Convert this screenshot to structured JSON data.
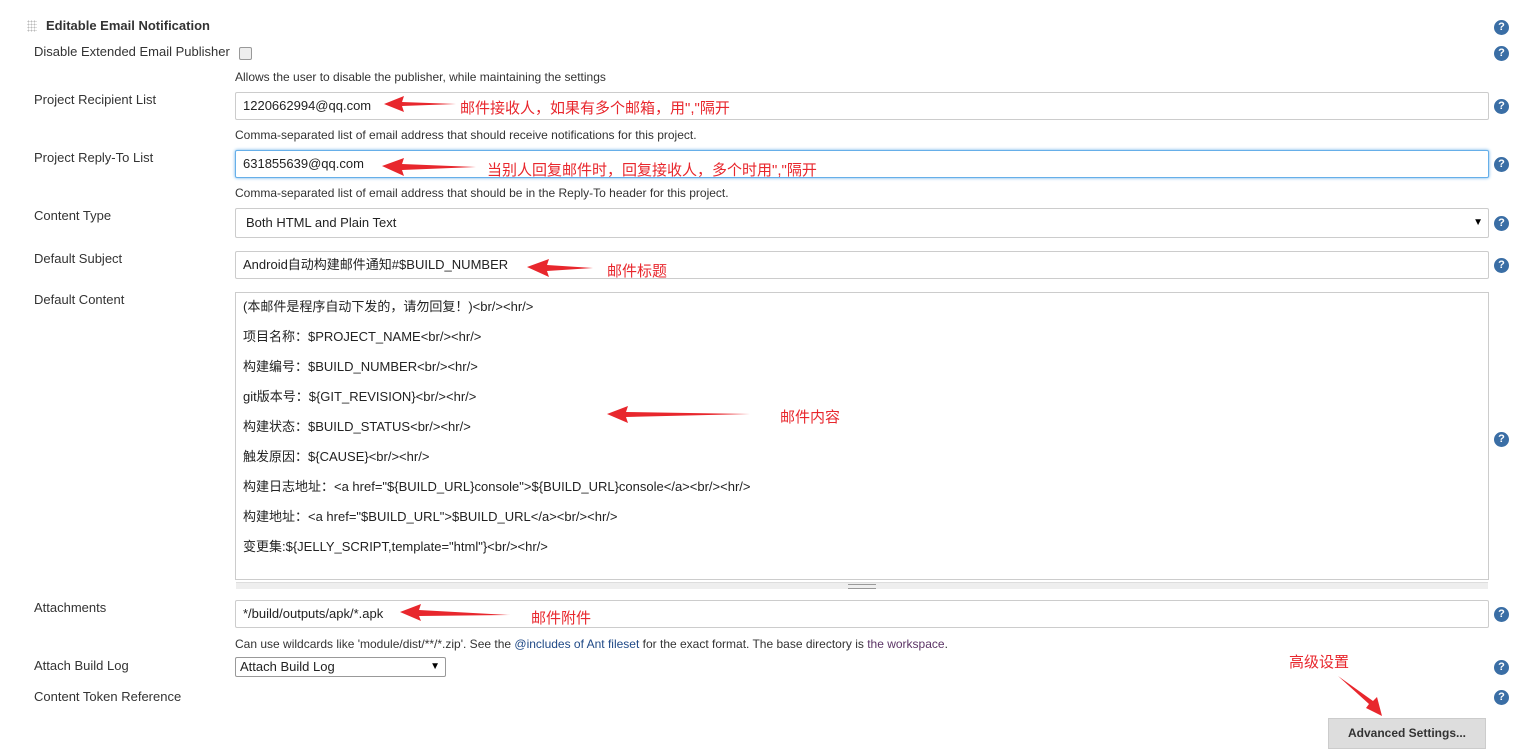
{
  "section_title": "Editable Email Notification",
  "disable": {
    "label": "Disable Extended Email Publisher",
    "checked": false,
    "desc": "Allows the user to disable the publisher, while maintaining the settings"
  },
  "recipient": {
    "label": "Project Recipient List",
    "value": "1220662994@qq.com",
    "desc": "Comma-separated list of email address that should receive notifications for this project.",
    "annotation": "邮件接收人，如果有多个邮箱，用\",\"隔开"
  },
  "reply_to": {
    "label": "Project Reply-To List",
    "value": "631855639@qq.com",
    "desc": "Comma-separated list of email address that should be in the Reply-To header for this project.",
    "annotation": "当别人回复邮件时，回复接收人，多个时用\",\"隔开"
  },
  "content_type": {
    "label": "Content Type",
    "value": "Both HTML and Plain Text"
  },
  "subject": {
    "label": "Default Subject",
    "value": "Android自动构建邮件通知#$BUILD_NUMBER",
    "annotation": "邮件标题"
  },
  "content": {
    "label": "Default Content",
    "annotation": "邮件内容",
    "lines": [
      "(本邮件是程序自动下发的，请勿回复！)<br/><hr/>",
      "项目名称：$PROJECT_NAME<br/><hr/>",
      "构建编号：$BUILD_NUMBER<br/><hr/>",
      "git版本号：${GIT_REVISION}<br/><hr/>",
      "构建状态：$BUILD_STATUS<br/><hr/>",
      "触发原因：${CAUSE}<br/><hr/>",
      "构建日志地址：<a href=\"${BUILD_URL}console\">${BUILD_URL}console</a><br/><hr/>",
      "构建地址：<a href=\"$BUILD_URL\">$BUILD_URL</a><br/><hr/>",
      "变更集:${JELLY_SCRIPT,template=\"html\"}<br/><hr/>"
    ]
  },
  "attachments": {
    "label": "Attachments",
    "value": "*/build/outputs/apk/*.apk",
    "annotation": "邮件附件",
    "desc_pre": "Can use wildcards like 'module/dist/**/*.zip'. See the ",
    "link1": "@includes of Ant fileset",
    "desc_mid": " for the exact format. The base directory is ",
    "link2": "the workspace",
    "desc_post": "."
  },
  "attach_log": {
    "label": "Attach Build Log",
    "value": "Attach Build Log"
  },
  "token_ref": {
    "label": "Content Token Reference"
  },
  "advanced": {
    "label": "Advanced Settings...",
    "annotation": "高级设置"
  },
  "help_icon": "?",
  "colors": {
    "annotation": "#e8272d",
    "focus": "#66afe9",
    "help": "#3a6ea5"
  }
}
